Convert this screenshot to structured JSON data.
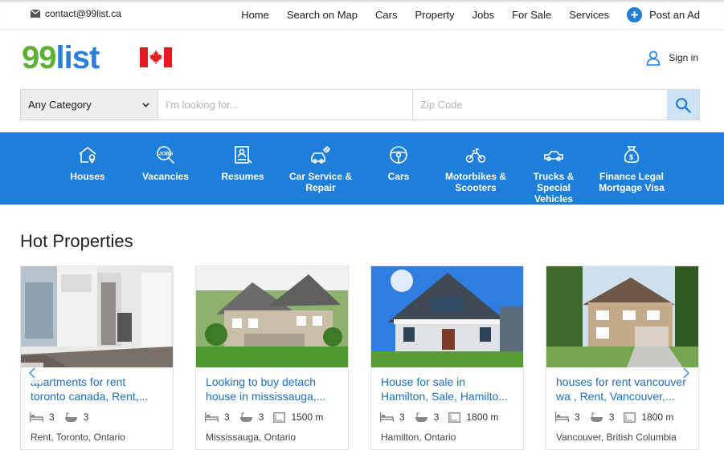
{
  "topbar": {
    "email": "contact@99list.ca",
    "nav": [
      "Home",
      "Search on Map",
      "Cars",
      "Property",
      "Jobs",
      "For Sale",
      "Services"
    ],
    "post_ad": "Post an Ad"
  },
  "header": {
    "logo_num": "99",
    "logo_word": "list",
    "signin": "Sign in"
  },
  "search": {
    "category": "Any Category",
    "query_placeholder": "I'm looking for...",
    "zip_placeholder": "Zip Code"
  },
  "categories": [
    {
      "label": "Houses",
      "icon": "house-pin-icon"
    },
    {
      "label": "Vacancies",
      "icon": "jobs-search-icon"
    },
    {
      "label": "Resumes",
      "icon": "resume-icon"
    },
    {
      "label": "Car Service & Repair",
      "icon": "car-service-icon"
    },
    {
      "label": "Cars",
      "icon": "steering-wheel-icon"
    },
    {
      "label": "Motorbikes & Scooters",
      "icon": "motorbike-icon"
    },
    {
      "label": "Trucks & Special Vehicles",
      "icon": "truck-icon"
    },
    {
      "label": "Finance Legal Mortgage Visa",
      "icon": "money-bag-icon"
    }
  ],
  "hot": {
    "title": "Hot Properties",
    "cards": [
      {
        "line1": "apartments for rent",
        "line2": "toronto canada, Rent,...",
        "beds": "3",
        "baths": "3",
        "area": "",
        "location": "Rent, Toronto, Ontario"
      },
      {
        "line1": "Looking to buy detach",
        "line2": "house in mississauga,...",
        "beds": "3",
        "baths": "3",
        "area": "1500 m",
        "location": "Mississauga, Ontario"
      },
      {
        "line1": "House for sale in",
        "line2": "Hamilton, Sale, Hamilto...",
        "beds": "3",
        "baths": "3",
        "area": "1800 m",
        "location": "Hamilton, Ontario"
      },
      {
        "line1": "houses for rent vancouver",
        "line2": "wa , Rent, Vancouver,...",
        "beds": "3",
        "baths": "3",
        "area": "1800 m",
        "location": "Vancouver, British Columbia"
      }
    ]
  },
  "colors": {
    "brand_blue": "#1d7fd9",
    "logo_green": "#5cb132",
    "link_blue": "#1d6fbf",
    "flag_red": "#e31b23"
  }
}
